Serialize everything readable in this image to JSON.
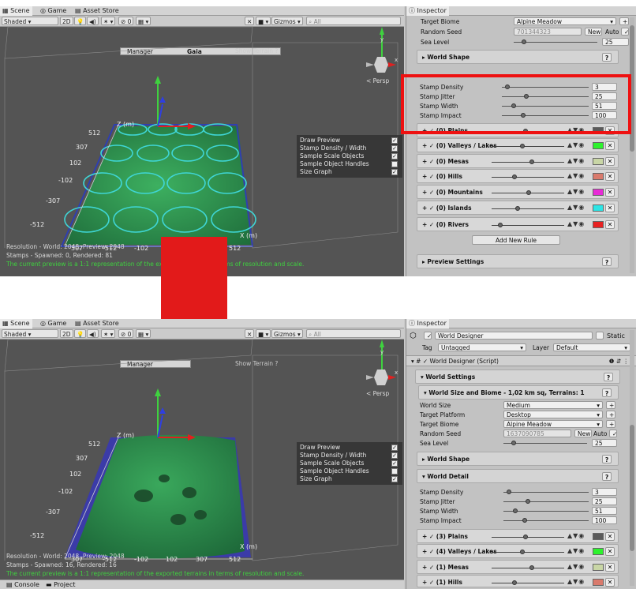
{
  "colors": {
    "highlight": "#e21a1a",
    "terrain_green": "#2f9a52",
    "stamp_cyan": "#3fd6d6",
    "status_green": "#3fd23f"
  },
  "tabs": {
    "scene": "Scene",
    "game": "Game",
    "asset_store": "Asset Store",
    "inspector": "Inspector",
    "console": "Console",
    "project": "Project"
  },
  "toolbar": {
    "shading": "Shaded",
    "mode_2d": "2D",
    "fx_count": "0",
    "gizmos": "Gizmos",
    "search_placeholder": "All"
  },
  "gaia": {
    "manager": "Manager",
    "gaia": "Gaia",
    "show_terrain": "Show Terrain",
    "persp": "< Persp",
    "axis_y": "y",
    "axis_x": "x",
    "axis_z": "z"
  },
  "draw_preview": {
    "items": [
      {
        "label": "Draw Preview",
        "checked": true
      },
      {
        "label": "Stamp Density / Width",
        "checked": true
      },
      {
        "label": "Sample Scale Objects",
        "checked": true
      },
      {
        "label": "Sample Object Handles",
        "checked": false
      },
      {
        "label": "Size Graph",
        "checked": true
      }
    ]
  },
  "axis_ticks": {
    "z": [
      "512",
      "307",
      "102",
      "-102",
      "-307",
      "-512"
    ],
    "x": [
      "307",
      "-102",
      "102",
      "307",
      "512"
    ],
    "z_unit": "Z (m)",
    "x_unit": "X (m)",
    "x_left": "-512"
  },
  "top": {
    "status": {
      "resolution": "Resolution - World: 2048, Preview: 2048",
      "stamps": "Stamps - Spawned: 0, Rendered: 81",
      "message": "The current preview is a 1:1 representation of the exported terrains in terms of resolution and scale."
    },
    "biome": {
      "target_biome_label": "Target Biome",
      "target_biome": "Alpine Meadow",
      "random_seed_label": "Random Seed",
      "random_seed": "701344323",
      "new_label": "New",
      "auto_label": "Auto",
      "sea_level_label": "Sea Level",
      "sea_level": "25"
    },
    "world_shape": "World Shape",
    "detail": [
      {
        "label": "Stamp Density",
        "value": "3"
      },
      {
        "label": "Stamp Jitter",
        "value": "25"
      },
      {
        "label": "Stamp Width",
        "value": "51"
      },
      {
        "label": "Stamp Impact",
        "value": "100"
      }
    ],
    "rules": [
      {
        "label": "(0) Plains",
        "color": "#5a5a5a"
      },
      {
        "label": "(0) Valleys / Lakes",
        "color": "#2df22d"
      },
      {
        "label": "(0) Mesas",
        "color": "#c9d6a6"
      },
      {
        "label": "(0) Hills",
        "color": "#d97a6c"
      },
      {
        "label": "(0) Mountains",
        "color": "#e82ad6"
      },
      {
        "label": "(0) Islands",
        "color": "#2de5e5"
      },
      {
        "label": "(0) Rivers",
        "color": "#e82020"
      }
    ],
    "add_rule": "Add New Rule",
    "preview_settings": "Preview Settings"
  },
  "bottom": {
    "status": {
      "resolution": "Resolution - World: 2048, Preview: 2048",
      "stamps": "Stamps - Spawned: 16, Rendered: 16",
      "message": "The current preview is a 1:1 representation of the exported terrains in terms of resolution and scale."
    },
    "object": {
      "name": "World Designer",
      "static": "Static",
      "tag_label": "Tag",
      "tag": "Untagged",
      "layer_label": "Layer",
      "layer": "Default",
      "component": "World Designer (Script)"
    },
    "world_settings": "World Settings",
    "world_size_header": "World Size and Biome - 1,02 km sq, Terrains: 1",
    "biome": {
      "world_size_label": "World Size",
      "world_size": "Medium",
      "target_platform_label": "Target Platform",
      "target_platform": "Desktop",
      "target_biome_label": "Target Biome",
      "target_biome": "Alpine Meadow",
      "random_seed_label": "Random Seed",
      "random_seed": "1637090785",
      "new_label": "New",
      "auto_label": "Auto",
      "sea_level_label": "Sea Level",
      "sea_level": "25"
    },
    "world_shape": "World Shape",
    "world_detail": "World Detail",
    "detail": [
      {
        "label": "Stamp Density",
        "value": "3"
      },
      {
        "label": "Stamp Jitter",
        "value": "25"
      },
      {
        "label": "Stamp Width",
        "value": "51"
      },
      {
        "label": "Stamp Impact",
        "value": "100"
      }
    ],
    "rules": [
      {
        "label": "(3) Plains",
        "color": "#5a5a5a"
      },
      {
        "label": "(4) Valleys / Lakes",
        "color": "#2df22d"
      },
      {
        "label": "(1) Mesas",
        "color": "#c9d6a6"
      },
      {
        "label": "(1) Hills",
        "color": "#d97a6c"
      }
    ]
  }
}
